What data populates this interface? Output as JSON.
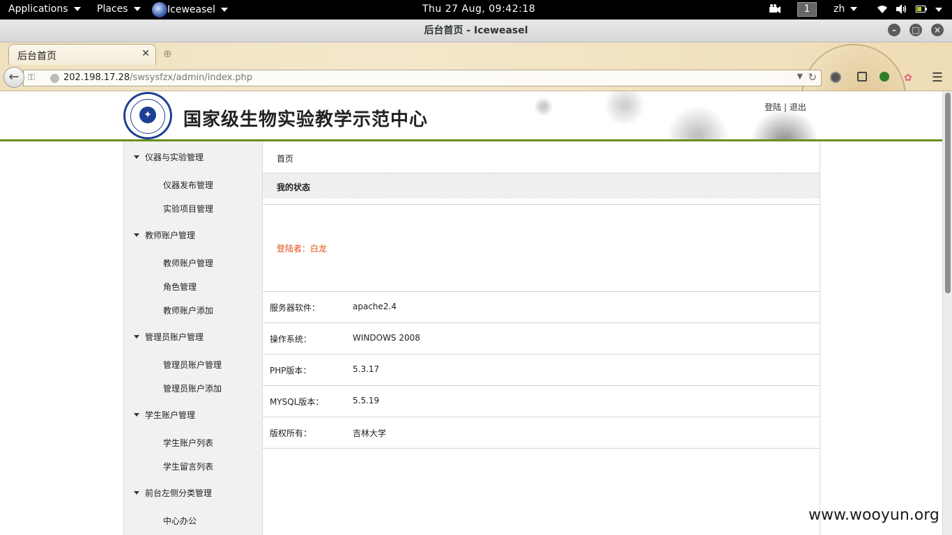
{
  "topbar": {
    "applications": "Applications",
    "places": "Places",
    "app": "Iceweasel",
    "clock": "Thu 27 Aug, 09:42:18",
    "workspace": "1",
    "lang": "zh"
  },
  "window": {
    "title": "后台首页 - Iceweasel"
  },
  "browser": {
    "tab_title": "后台首页",
    "url_host": "202.198.17.28",
    "url_path": "/swsysfzx/admin/index.php"
  },
  "site": {
    "title": "国家级生物实验教学示范中心",
    "login_link": "登陆",
    "separator": "|",
    "logout_link": "退出"
  },
  "sidebar": {
    "groups": [
      {
        "label": "仪器与实验管理",
        "items": [
          "仪器发布管理",
          "实验项目管理"
        ]
      },
      {
        "label": "教师账户管理",
        "items": [
          "教师账户管理",
          "角色管理",
          "教师账户添加"
        ]
      },
      {
        "label": "管理员账户管理",
        "items": [
          "管理员账户管理",
          "管理员账户添加"
        ]
      },
      {
        "label": "学生账户管理",
        "items": [
          "学生账户列表",
          "学生留言列表"
        ]
      },
      {
        "label": "前台左侧分类管理",
        "items": [
          "中心办公"
        ]
      }
    ]
  },
  "main": {
    "breadcrumb": "首页",
    "status_title": "我的状态",
    "login_user": "登陆者：白龙",
    "info": [
      {
        "label": "服务器软件：",
        "value": "apache2.4"
      },
      {
        "label": "操作系统：",
        "value": "WINDOWS 2008"
      },
      {
        "label": "PHP版本：",
        "value": "5.3.17"
      },
      {
        "label": "MYSQL版本：",
        "value": "5.5.19"
      },
      {
        "label": "版权所有：",
        "value": "吉林大学"
      }
    ]
  },
  "watermark": "www.wooyun.org",
  "colors": {
    "accent_green": "#6a8f1e",
    "login_orange": "#e04e10",
    "logo_blue": "#1e3f93"
  }
}
